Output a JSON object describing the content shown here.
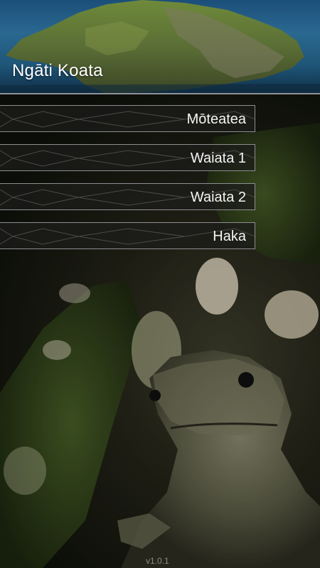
{
  "header": {
    "title": "Ngāti Koata"
  },
  "menu": {
    "items": [
      {
        "label": "Mōteatea"
      },
      {
        "label": "Waiata 1"
      },
      {
        "label": "Waiata 2"
      },
      {
        "label": "Haka"
      }
    ]
  },
  "footer": {
    "version": "v1.0.1"
  }
}
